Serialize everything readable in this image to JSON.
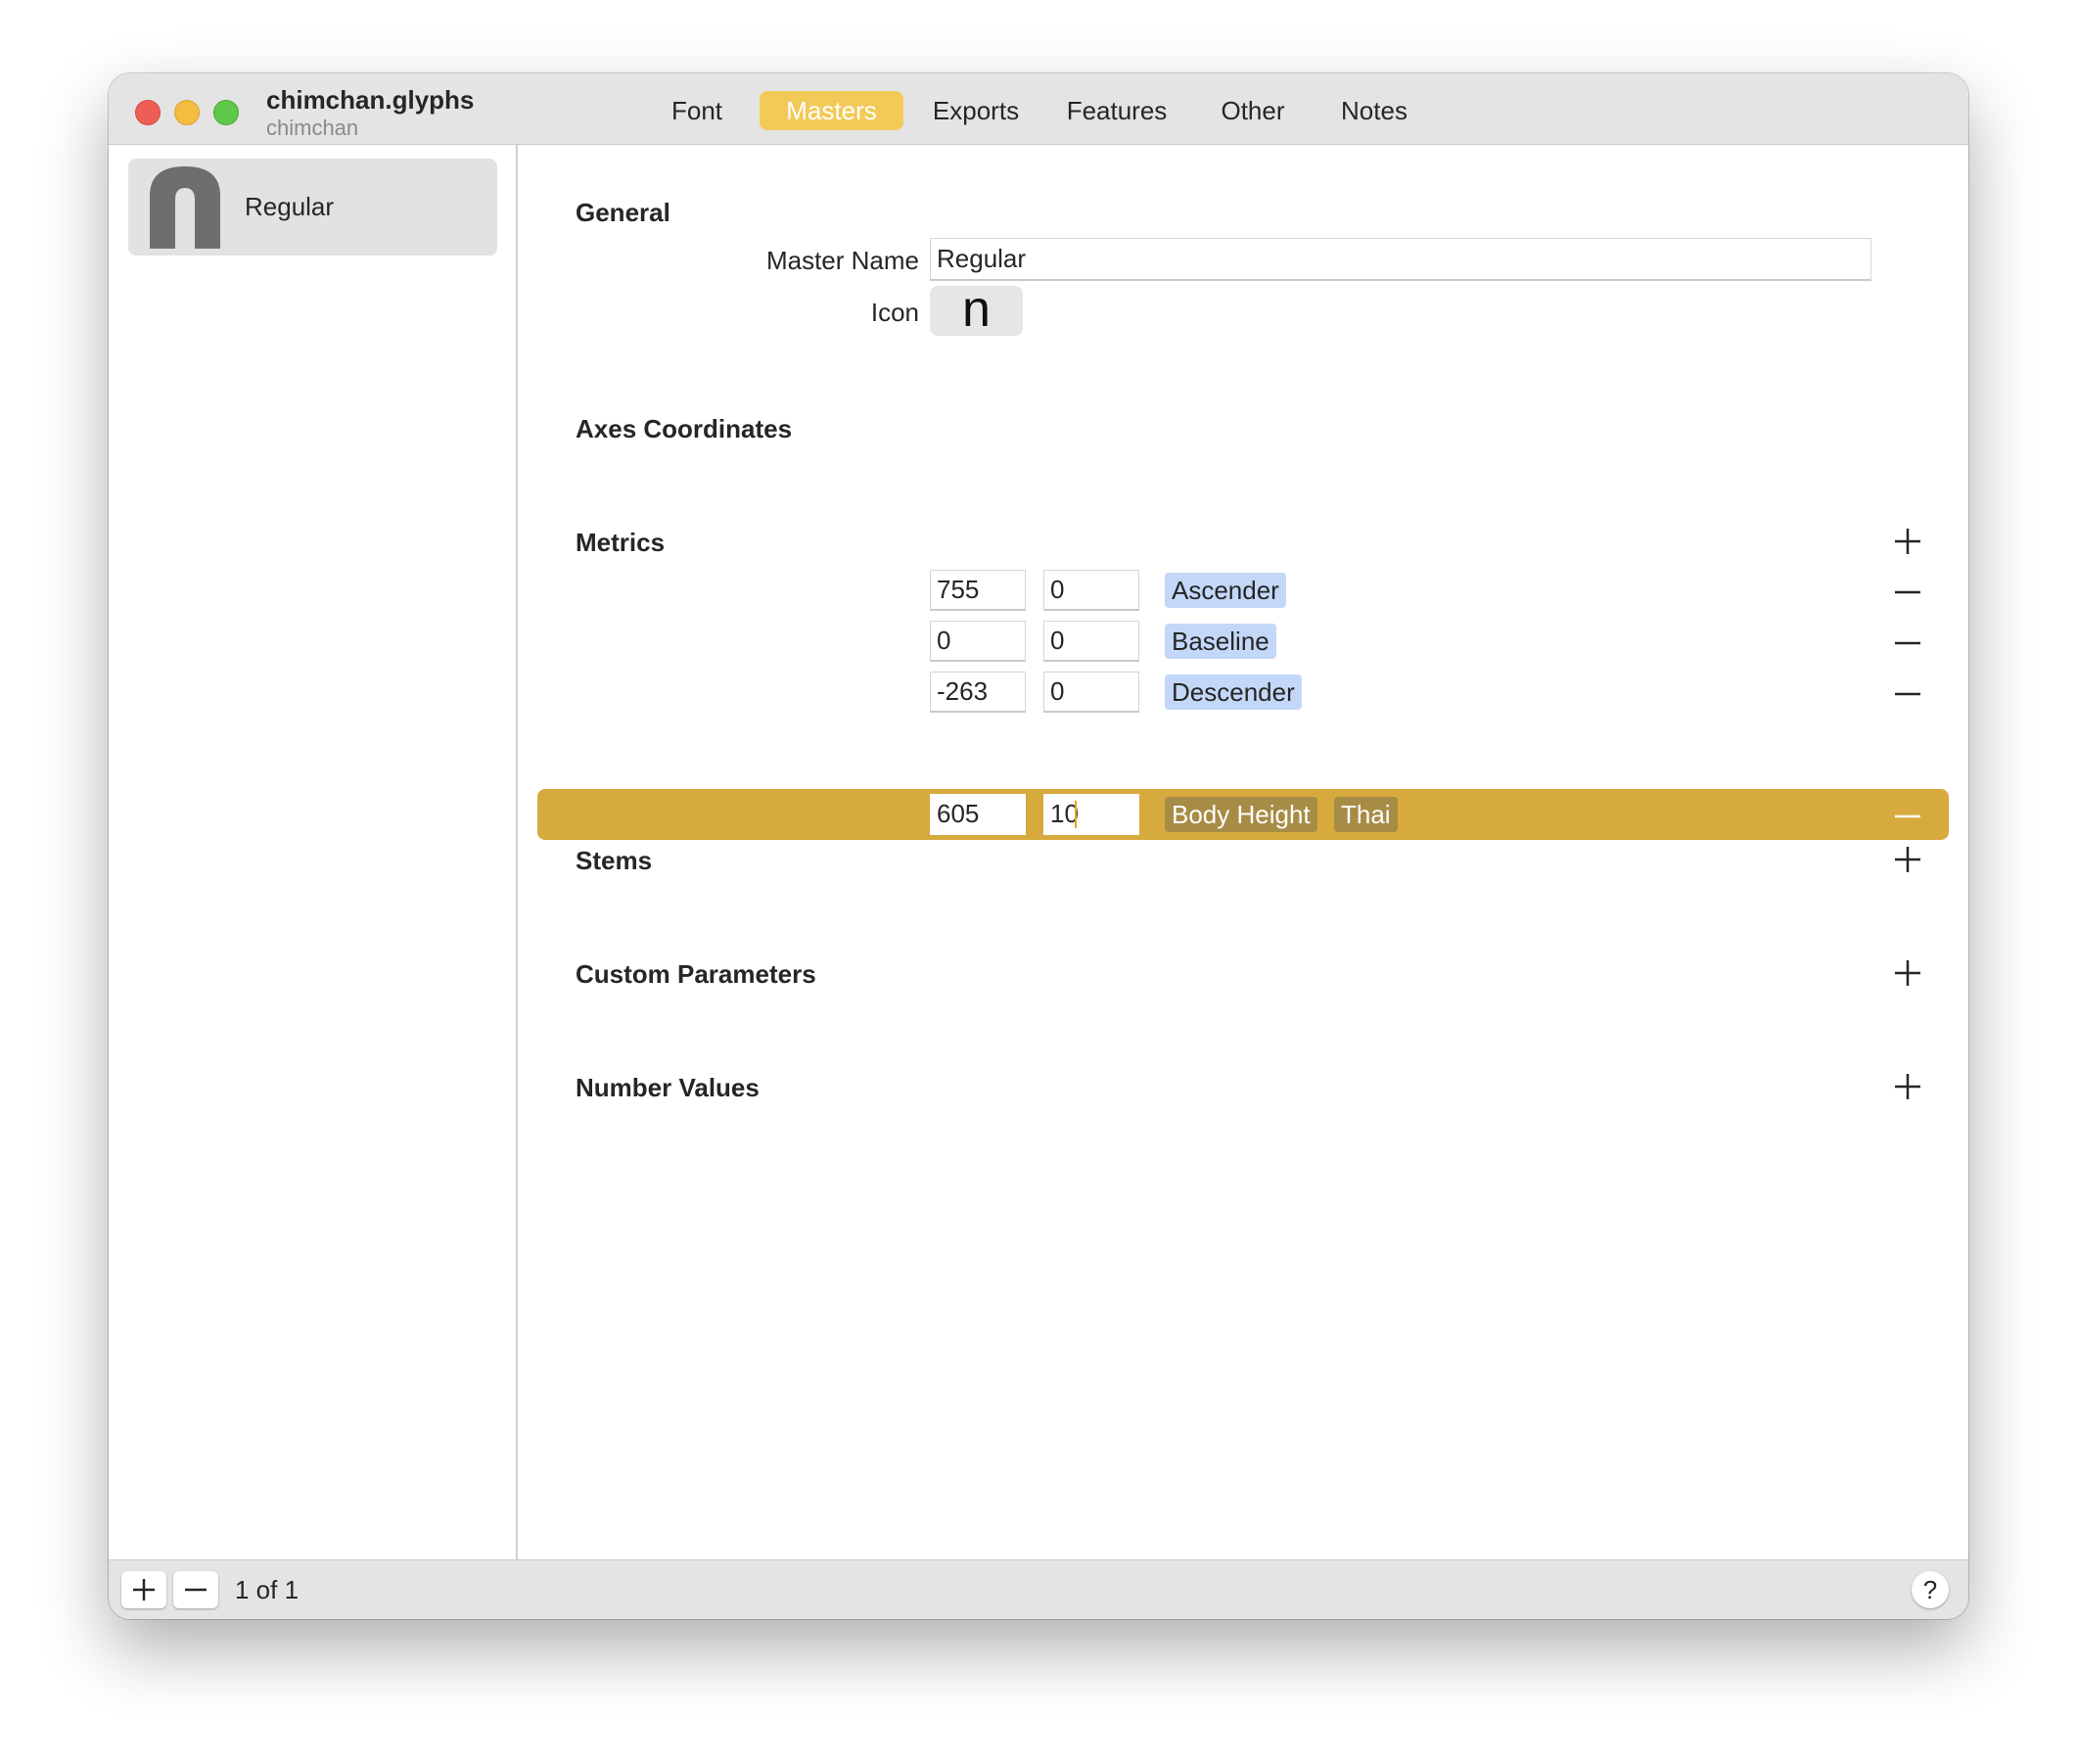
{
  "window": {
    "title": "chimchan.glyphs",
    "subtitle": "chimchan"
  },
  "tabs": [
    {
      "label": "Font",
      "active": false
    },
    {
      "label": "Masters",
      "active": true
    },
    {
      "label": "Exports",
      "active": false
    },
    {
      "label": "Features",
      "active": false
    },
    {
      "label": "Other",
      "active": false
    },
    {
      "label": "Notes",
      "active": false
    }
  ],
  "sidebar": {
    "masters": [
      {
        "name": "Regular",
        "icon": "n-glyph-icon",
        "selected": true
      }
    ]
  },
  "general": {
    "section_title": "General",
    "master_name_label": "Master Name",
    "master_name_value": "Regular",
    "icon_label": "Icon",
    "icon_glyph": "n"
  },
  "axes": {
    "section_title": "Axes Coordinates"
  },
  "metrics": {
    "section_title": "Metrics",
    "rows": [
      {
        "position": "755",
        "overshoot": "0",
        "name": "Ascender",
        "filter": "",
        "selected": false
      },
      {
        "position": "0",
        "overshoot": "0",
        "name": "Baseline",
        "filter": "",
        "selected": false
      },
      {
        "position": "-263",
        "overshoot": "0",
        "name": "Descender",
        "filter": "",
        "selected": false
      },
      {
        "position": "605",
        "overshoot": "10",
        "name": "Body Height",
        "filter": "Thai",
        "selected": true
      }
    ]
  },
  "stems": {
    "section_title": "Stems"
  },
  "custom_parameters": {
    "section_title": "Custom Parameters"
  },
  "number_values": {
    "section_title": "Number Values"
  },
  "bottombar": {
    "page_count": "1 of 1",
    "help_label": "?"
  },
  "colors": {
    "active_tab": "#f3c957",
    "selected_row": "#d7aa3d",
    "metric_token": "#c3d8f8",
    "selected_token": "#a78c45"
  }
}
